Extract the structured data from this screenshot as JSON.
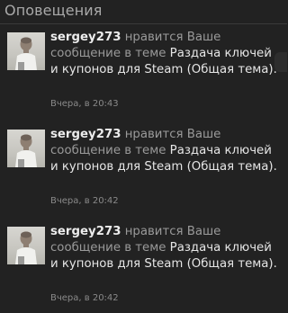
{
  "header": {
    "title": "Оповещения"
  },
  "notifications": [
    {
      "username": "sergey273",
      "action": "нравится Ваше сообщение в теме",
      "thread": "Раздача ключей и купонов для Steam (Общая тема).",
      "time": "Вчера, в 20:43"
    },
    {
      "username": "sergey273",
      "action": "нравится Ваше сообщение в теме",
      "thread": "Раздача ключей и купонов для Steam (Общая тема).",
      "time": "Вчера, в 20:42"
    },
    {
      "username": "sergey273",
      "action": "нравится Ваше сообщение в теме",
      "thread": "Раздача ключей и купонов для Steam (Общая тема).",
      "time": "Вчера, в 20:42"
    }
  ]
}
